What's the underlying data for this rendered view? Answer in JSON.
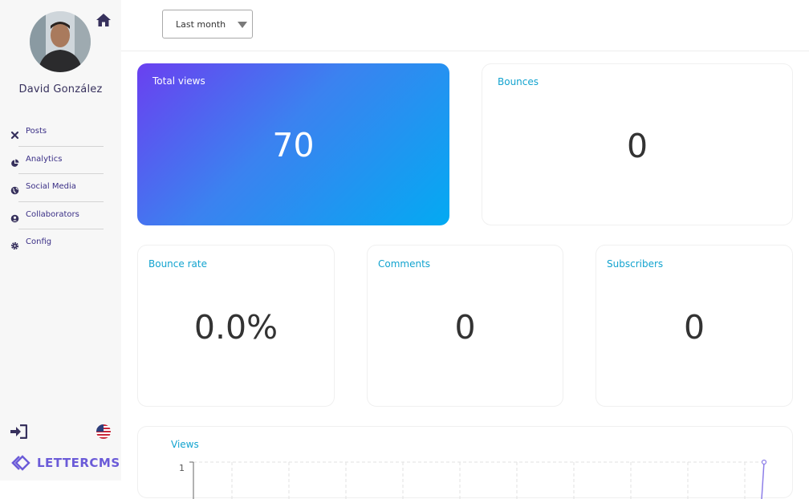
{
  "sidebar": {
    "user_name": "David González",
    "nav": [
      {
        "label": "Posts",
        "icon": "close-icon"
      },
      {
        "label": "Analytics",
        "icon": "pie-chart-icon"
      },
      {
        "label": "Social Media",
        "icon": "globe-icon"
      },
      {
        "label": "Collaborators",
        "icon": "user-circle-icon"
      },
      {
        "label": "Config",
        "icon": "gear-icon"
      }
    ],
    "brand": "LETTERCMS"
  },
  "filter": {
    "selected": "Last month"
  },
  "cards": {
    "total_views": {
      "title": "Total views",
      "value": "70"
    },
    "bounces": {
      "title": "Bounces",
      "value": "0"
    },
    "bounce_rate": {
      "title": "Bounce rate",
      "value": "0.0%"
    },
    "comments": {
      "title": "Comments",
      "value": "0"
    },
    "subscribers": {
      "title": "Subscribers",
      "value": "0"
    }
  },
  "colors": {
    "accent": "#12a3cf",
    "nav_text": "#3a2f86",
    "brand": "#6b5bd8"
  },
  "chart_data": {
    "type": "line",
    "title": "Views",
    "ytick_labels": [
      "1"
    ],
    "ylim": [
      0,
      1
    ],
    "y_last": 1,
    "grid": true
  }
}
